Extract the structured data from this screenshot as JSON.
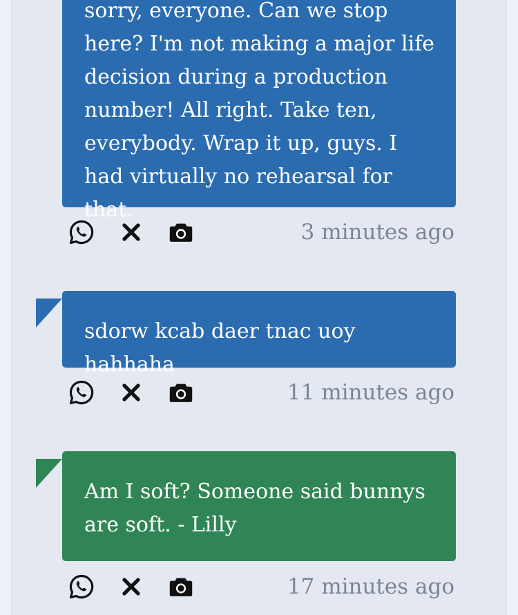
{
  "messages": [
    {
      "text": "sorry, everyone. Can we stop here? I'm not making a major life decision during a production number! All right. Take ten, everybody. Wrap it up, guys. I had virtually no rehearsal for that.",
      "time": "3 minutes ago",
      "color": "#2b6cb0"
    },
    {
      "text": "sdorw kcab daer tnac uoy hahhaha",
      "time": "11 minutes ago",
      "color": "#2b6cb0"
    },
    {
      "text": "Am I soft? Someone said bunnys are soft. - Lilly",
      "time": "17 minutes ago",
      "color": "#2f8555"
    }
  ],
  "actions": {
    "share_icon": "whatsapp-icon",
    "delete_icon": "close-icon",
    "snapshot_icon": "camera-icon"
  },
  "colors": {
    "panel_bg": "#e4e8f1",
    "icon": "#111111",
    "timestamp": "#7c8596"
  }
}
